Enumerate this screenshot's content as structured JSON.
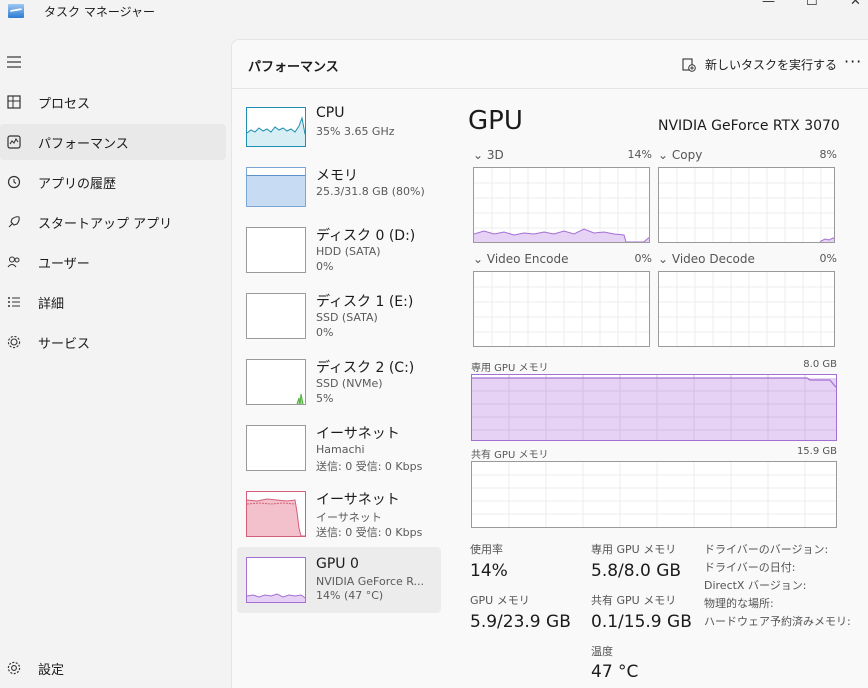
{
  "window": {
    "title": "タスク マネージャー"
  },
  "nav": {
    "items": [
      {
        "label": "プロセス",
        "icon": "process-icon"
      },
      {
        "label": "パフォーマンス",
        "icon": "performance-icon",
        "active": true
      },
      {
        "label": "アプリの履歴",
        "icon": "history-icon"
      },
      {
        "label": "スタートアップ アプリ",
        "icon": "startup-icon"
      },
      {
        "label": "ユーザー",
        "icon": "users-icon"
      },
      {
        "label": "詳細",
        "icon": "details-icon"
      },
      {
        "label": "サービス",
        "icon": "services-icon"
      }
    ],
    "settings_label": "設定"
  },
  "header": {
    "title": "パフォーマンス",
    "run_task_label": "新しいタスクを実行する",
    "more_label": "···"
  },
  "devices": [
    {
      "name": "CPU",
      "line1": "35%  3.65 GHz",
      "line2": "",
      "line3": ""
    },
    {
      "name": "メモリ",
      "line1": "25.3/31.8 GB (80%)",
      "line2": "",
      "line3": ""
    },
    {
      "name": "ディスク 0 (D:)",
      "line1": "HDD (SATA)",
      "line2": "0%",
      "line3": ""
    },
    {
      "name": "ディスク 1 (E:)",
      "line1": "SSD (SATA)",
      "line2": "0%",
      "line3": ""
    },
    {
      "name": "ディスク 2 (C:)",
      "line1": "SSD (NVMe)",
      "line2": "5%",
      "line3": ""
    },
    {
      "name": "イーサネット",
      "line1": "Hamachi",
      "line2": "送信: 0 受信: 0 Kbps",
      "line3": ""
    },
    {
      "name": "イーサネット",
      "line1": "イーサネット",
      "line2": "送信: 0 受信: 0 Kbps",
      "line3": ""
    },
    {
      "name": "GPU 0",
      "line1": "NVIDIA GeForce R...",
      "line2": "14%  (47 °C)",
      "line3": ""
    }
  ],
  "gpu": {
    "title": "GPU",
    "model": "NVIDIA GeForce RTX 3070",
    "engines": [
      {
        "label": "3D",
        "pct": "14%"
      },
      {
        "label": "Copy",
        "pct": "8%"
      },
      {
        "label": "Video Encode",
        "pct": "0%"
      },
      {
        "label": "Video Decode",
        "pct": "0%"
      }
    ],
    "dedicated_mem_label": "専用 GPU メモリ",
    "dedicated_mem_max": "8.0 GB",
    "shared_mem_label": "共有 GPU メモリ",
    "shared_mem_max": "15.9 GB",
    "stats": {
      "usage_label": "使用率",
      "usage_value": "14%",
      "dedicated_label": "専用 GPU メモリ",
      "dedicated_value": "5.8/8.0 GB",
      "gpu_mem_label": "GPU メモリ",
      "gpu_mem_value": "5.9/23.9 GB",
      "shared_label": "共有 GPU メモリ",
      "shared_value": "0.1/15.9 GB",
      "temp_label": "温度",
      "temp_value": "47 °C"
    },
    "info_labels": [
      "ドライバーのバージョン:",
      "ドライバーの日付:",
      "DirectX バージョン:",
      "物理的な場所:",
      "ハードウェア予約済みメモリ:"
    ]
  },
  "colors": {
    "gpu_accent": "#a46fd4",
    "gpu_fill": "#e6d2f5",
    "cpu_accent": "#1f8fb0",
    "mem_accent": "#7aa6d8",
    "eth_accent": "#d45f7a",
    "disk_accent": "#4caf3a"
  }
}
